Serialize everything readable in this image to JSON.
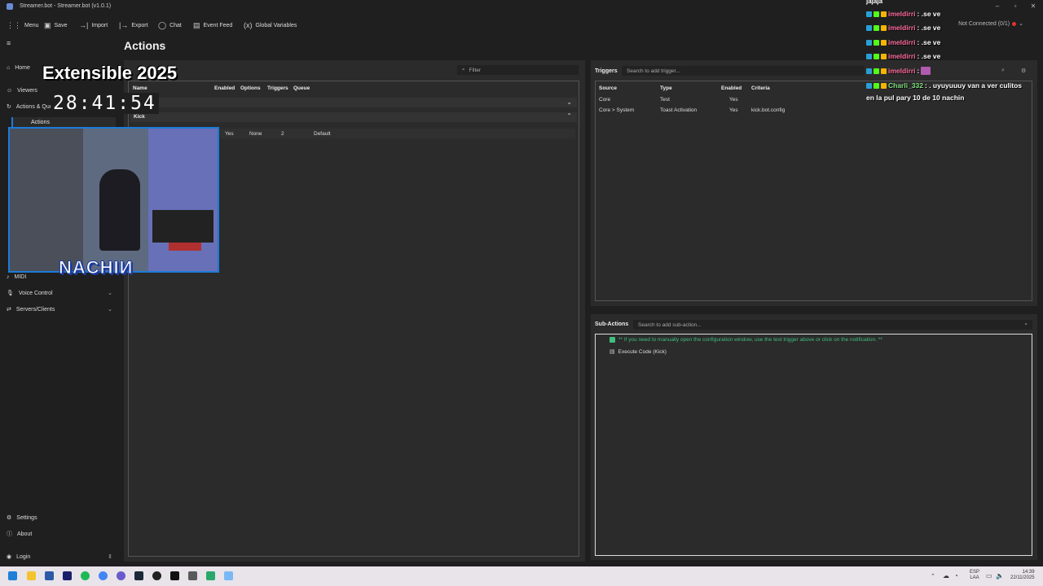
{
  "window": {
    "title": "Streamer.bot - Streamer.bot (v1.0.1)"
  },
  "toolbar": {
    "menu": "Menu",
    "save": "Save",
    "import": "Import",
    "export": "Export",
    "chat": "Chat",
    "event_feed": "Event Feed",
    "global_variables": "Global Variables",
    "connection_status": "Not Connected (0/1)"
  },
  "sidebar": {
    "home": "Home",
    "viewers": "Viewers",
    "actions_queues": "Actions & Queues",
    "actions": "Actions",
    "midi": "MIDI",
    "voice_control": "Voice Control",
    "servers_clients": "Servers/Clients",
    "settings": "Settings",
    "about": "About",
    "login": "Login"
  },
  "page": {
    "title": "Actions"
  },
  "actions_panel": {
    "filter_placeholder": "Filter",
    "columns": {
      "name": "Name",
      "enabled": "Enabled",
      "options": "Options",
      "triggers": "Triggers",
      "queue": "Queue"
    },
    "group": "Kick",
    "row": {
      "enabled": "Yes",
      "options": "None",
      "triggers": "2",
      "queue": "Default"
    }
  },
  "triggers_panel": {
    "label": "Triggers",
    "search_placeholder": "Search to add trigger...",
    "columns": {
      "source": "Source",
      "type": "Type",
      "enabled": "Enabled",
      "criteria": "Criteria"
    },
    "rows": [
      {
        "source": "Core",
        "type": "Test",
        "enabled": "Yes",
        "criteria": ""
      },
      {
        "source": "Core > System",
        "type": "Toast Activation",
        "enabled": "Yes",
        "criteria": "kick.bot.config"
      }
    ]
  },
  "subactions_panel": {
    "label": "Sub-Actions",
    "search_placeholder": "Search to add sub-action...",
    "comment": "** If you need to manually open the configuration window, use the test trigger above or click on the notification. **",
    "item": "Execute Code (Kick)"
  },
  "overlay": {
    "title": "Extensible 2025",
    "timer": "28:41:54",
    "streamer_name": "NACHIИ"
  },
  "chat": {
    "top_text": "jajaja",
    "lines": [
      {
        "user": "imeldirri",
        "message": ": .se ve",
        "color": "#ff6fa0"
      },
      {
        "user": "imeldirri",
        "message": ": .se ve",
        "color": "#ff6fa0"
      },
      {
        "user": "imeldirri",
        "message": ": .se ve",
        "color": "#ff6fa0"
      },
      {
        "user": "imeldirri",
        "message": ": .se ve",
        "color": "#ff6fa0"
      },
      {
        "user": "imeldirri",
        "message": ":",
        "color": "#ff6fa0"
      },
      {
        "user": "Charli_332",
        "message": ": . uyuyuuuy van a ver culitos",
        "color": "#7fe07f"
      }
    ],
    "continuation": "en la pul pary 10 de 10 nachin"
  },
  "taskbar": {
    "lang": "ESP",
    "region": "LAA",
    "time": "14:39",
    "date": "22/11/2025"
  },
  "colors": {
    "accent": "#1c7bd8",
    "status_dot": "#dd3333",
    "comment_green": "#3fbf7f"
  }
}
